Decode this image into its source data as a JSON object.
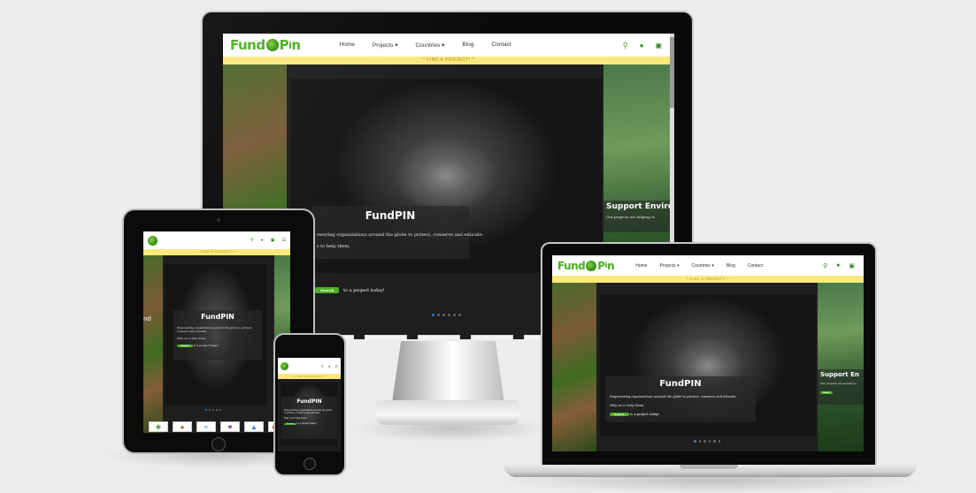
{
  "site": {
    "logo_text_a": "Fund",
    "logo_text_b": "P",
    "logo_text_c": "n",
    "nav_links": [
      "Home",
      "Projects ▾",
      "Countries ▾",
      "Blog",
      "Contact"
    ],
    "banner": "* FIND A PROJECT! *",
    "hero_title": "FundPIN",
    "hero_text_1": "Empowering organizations around the globe to protect, conserve and educate.",
    "hero_text_1_cropped": "owering organizations around the globe to protect, conserve and educate.",
    "hero_text_2": "Help us to help them.",
    "hero_text_2_cropped": "s to help them.",
    "hero_cta_btn": "Search",
    "hero_cta_text": "to a project today!",
    "side_right_title": "Support Enviro",
    "side_right_title_mb": "Support En",
    "side_right_text": "Our projects are helping to sustain our planet",
    "side_right_text_short": "Our projects are helping to",
    "side_left_title": "nd"
  },
  "icons": {
    "search": "search-icon",
    "user": "user-icon",
    "cart": "cart-icon",
    "menu": "menu-icon"
  },
  "colors": {
    "brand_green": "#4caf22",
    "banner_yellow": "#fbe97e",
    "banner_text": "#b68a1a",
    "dot_active": "#3a7bd5"
  }
}
